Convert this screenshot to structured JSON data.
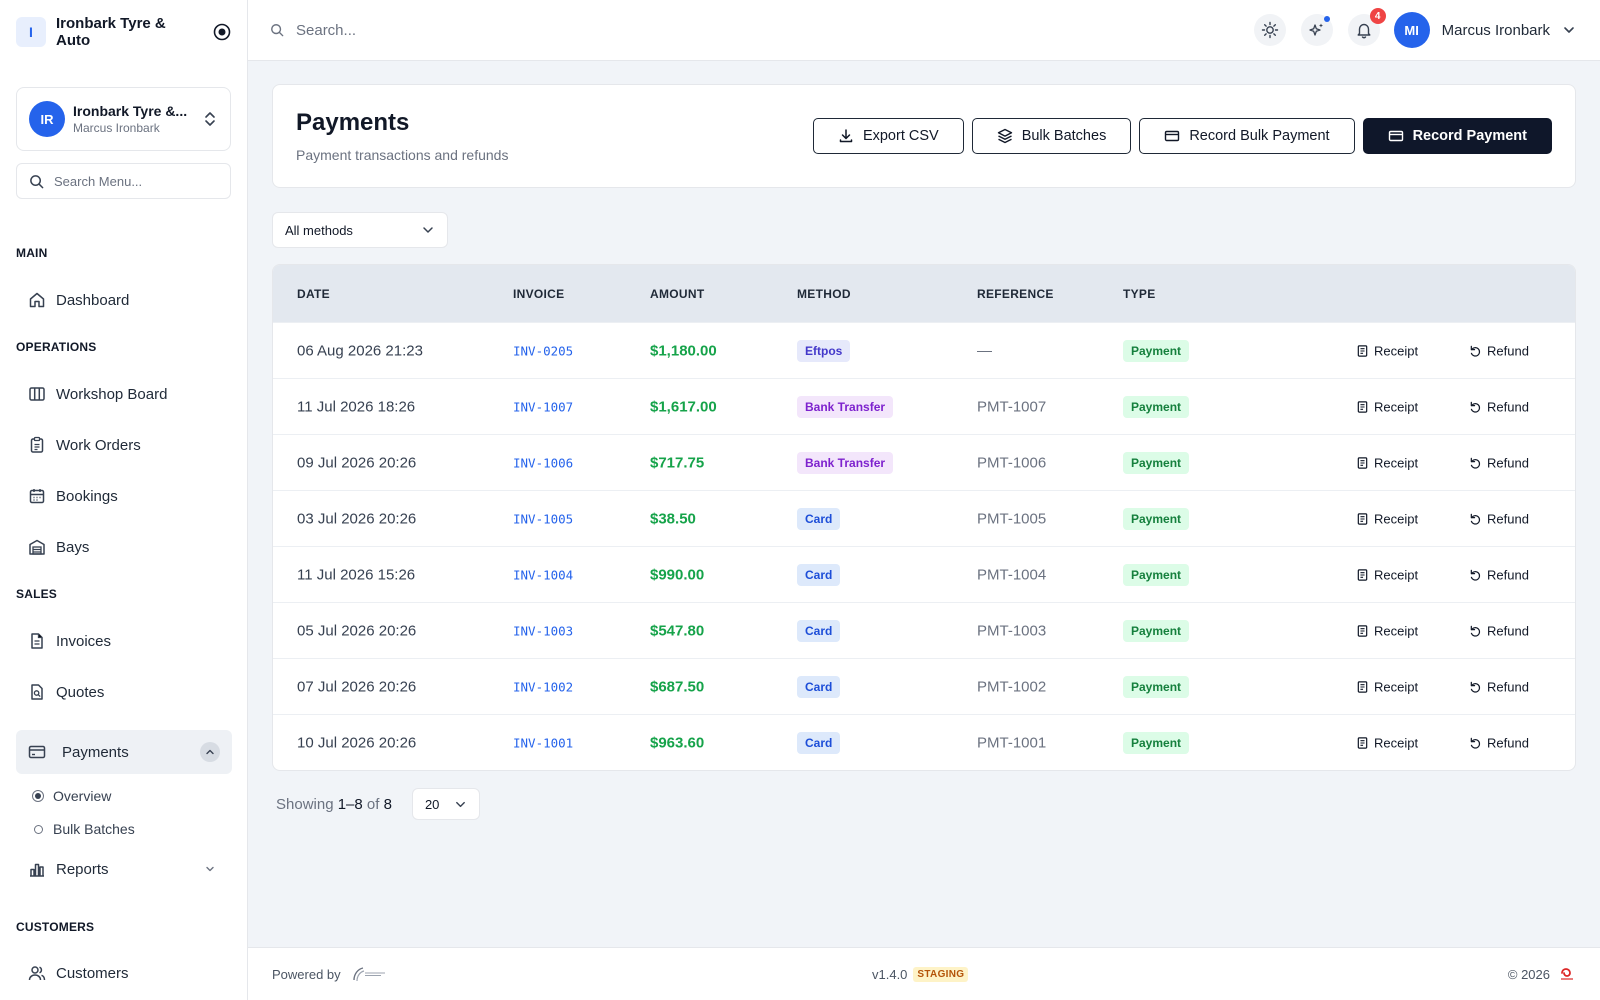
{
  "brand": {
    "initial": "I",
    "name": "Ironbark Tyre & Auto"
  },
  "org": {
    "initials": "IR",
    "name": "Ironbark Tyre &...",
    "user": "Marcus Ironbark"
  },
  "sidebar": {
    "search_placeholder": "Search Menu...",
    "sections": {
      "main": "MAIN",
      "operations": "OPERATIONS",
      "sales": "SALES",
      "customers": "CUSTOMERS"
    },
    "items": {
      "dashboard": "Dashboard",
      "workshop_board": "Workshop Board",
      "work_orders": "Work Orders",
      "bookings": "Bookings",
      "bays": "Bays",
      "invoices": "Invoices",
      "quotes": "Quotes",
      "payments": "Payments",
      "overview": "Overview",
      "bulk_batches": "Bulk Batches",
      "reports": "Reports",
      "customers": "Customers"
    }
  },
  "topbar": {
    "search_placeholder": "Search...",
    "notification_count": "4",
    "user_initials": "MI",
    "user_name": "Marcus Ironbark"
  },
  "page": {
    "title": "Payments",
    "subtitle": "Payment transactions and refunds",
    "actions": {
      "export": "Export CSV",
      "bulk_batches": "Bulk Batches",
      "record_bulk": "Record Bulk Payment",
      "record": "Record Payment"
    }
  },
  "filter": {
    "method": "All methods"
  },
  "table": {
    "headers": {
      "date": "DATE",
      "invoice": "INVOICE",
      "amount": "AMOUNT",
      "method": "METHOD",
      "reference": "REFERENCE",
      "type": "TYPE"
    },
    "receipt_label": "Receipt",
    "refund_label": "Refund",
    "rows": [
      {
        "date": "06 Aug 2026 21:23",
        "invoice": "INV-0205",
        "amount": "$1,180.00",
        "method": "Eftpos",
        "reference": "—",
        "type": "Payment"
      },
      {
        "date": "11 Jul 2026 18:26",
        "invoice": "INV-1007",
        "amount": "$1,617.00",
        "method": "Bank Transfer",
        "reference": "PMT-1007",
        "type": "Payment"
      },
      {
        "date": "09 Jul 2026 20:26",
        "invoice": "INV-1006",
        "amount": "$717.75",
        "method": "Bank Transfer",
        "reference": "PMT-1006",
        "type": "Payment"
      },
      {
        "date": "03 Jul 2026 20:26",
        "invoice": "INV-1005",
        "amount": "$38.50",
        "method": "Card",
        "reference": "PMT-1005",
        "type": "Payment"
      },
      {
        "date": "11 Jul 2026 15:26",
        "invoice": "INV-1004",
        "amount": "$990.00",
        "method": "Card",
        "reference": "PMT-1004",
        "type": "Payment"
      },
      {
        "date": "05 Jul 2026 20:26",
        "invoice": "INV-1003",
        "amount": "$547.80",
        "method": "Card",
        "reference": "PMT-1003",
        "type": "Payment"
      },
      {
        "date": "07 Jul 2026 20:26",
        "invoice": "INV-1002",
        "amount": "$687.50",
        "method": "Card",
        "reference": "PMT-1002",
        "type": "Payment"
      },
      {
        "date": "10 Jul 2026 20:26",
        "invoice": "INV-1001",
        "amount": "$963.60",
        "method": "Card",
        "reference": "PMT-1001",
        "type": "Payment"
      }
    ]
  },
  "pagination": {
    "showing": "Showing",
    "range": "1–8",
    "of": "of",
    "total": "8",
    "per_page": "20"
  },
  "footer": {
    "powered_by": "Powered by",
    "version": "v1.4.0",
    "env": "STAGING",
    "copyright": "© 2026"
  },
  "colors": {
    "accent": "#2563eb",
    "primary_button": "#0f172a",
    "amount": "#16a34a",
    "badge": "#ef4444"
  }
}
